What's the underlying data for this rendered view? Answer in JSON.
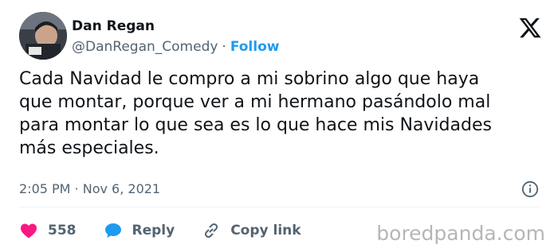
{
  "author": {
    "display_name": "Dan Regan",
    "handle": "@DanRegan_Comedy",
    "separator": "·",
    "follow_label": "Follow"
  },
  "tweet": {
    "lines": [
      "Cada Navidad le compro a mi sobrino algo que haya",
      "que montar, porque ver a mi hermano pasándolo mal",
      "para montar lo que sea es lo que hace mis Navidades",
      "más especiales."
    ],
    "timestamp": "2:05 PM · Nov 6, 2021"
  },
  "actions": {
    "like_count": "558",
    "reply_label": "Reply",
    "copy_link_label": "Copy link"
  },
  "icons": {
    "brand": "x-logo-icon",
    "info": "info-icon",
    "like": "heart-icon",
    "reply": "reply-bubble-icon",
    "copy_link": "link-icon"
  },
  "colors": {
    "text": "#0f1419",
    "secondary": "#536471",
    "follow": "#1d9bf0",
    "like": "#f91880",
    "reply": "#1d9bf0"
  },
  "watermark": "boredpanda.com"
}
